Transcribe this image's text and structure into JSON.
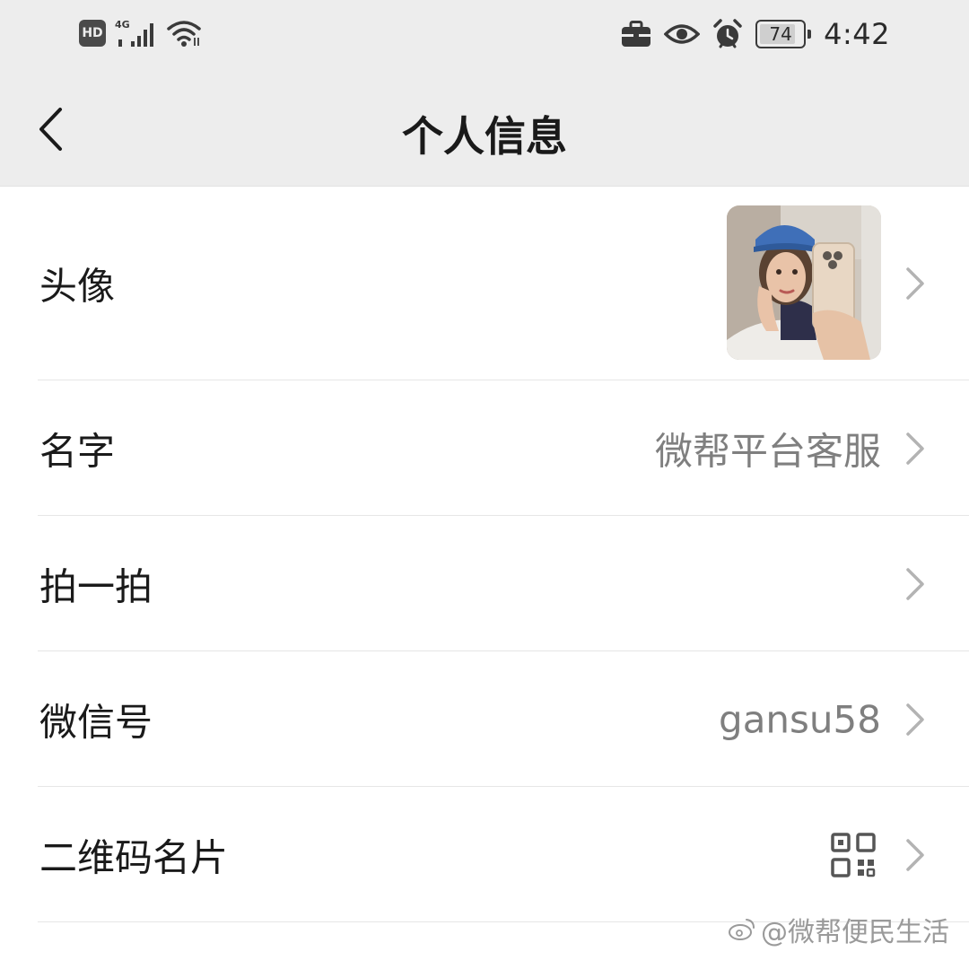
{
  "status_bar": {
    "network_badge": "HD",
    "network_type": "4G",
    "battery_level": "74",
    "time": "4:42",
    "icons": [
      "hd-icon",
      "signal-icon",
      "wifi-icon",
      "briefcase-icon",
      "eye-icon",
      "alarm-icon",
      "battery-icon"
    ]
  },
  "header": {
    "title": "个人信息"
  },
  "rows": [
    {
      "label": "头像",
      "type": "avatar"
    },
    {
      "label": "名字",
      "value": "微帮平台客服"
    },
    {
      "label": "拍一拍",
      "value": ""
    },
    {
      "label": "微信号",
      "value": "gansu58"
    },
    {
      "label": "二维码名片",
      "type": "qr"
    }
  ],
  "watermark": {
    "text": "@微帮便民生活"
  },
  "colors": {
    "header_bg": "#ededed",
    "body_bg": "#ffffff",
    "value_text": "#7f7f7f",
    "divider": "#e6e6e6"
  }
}
